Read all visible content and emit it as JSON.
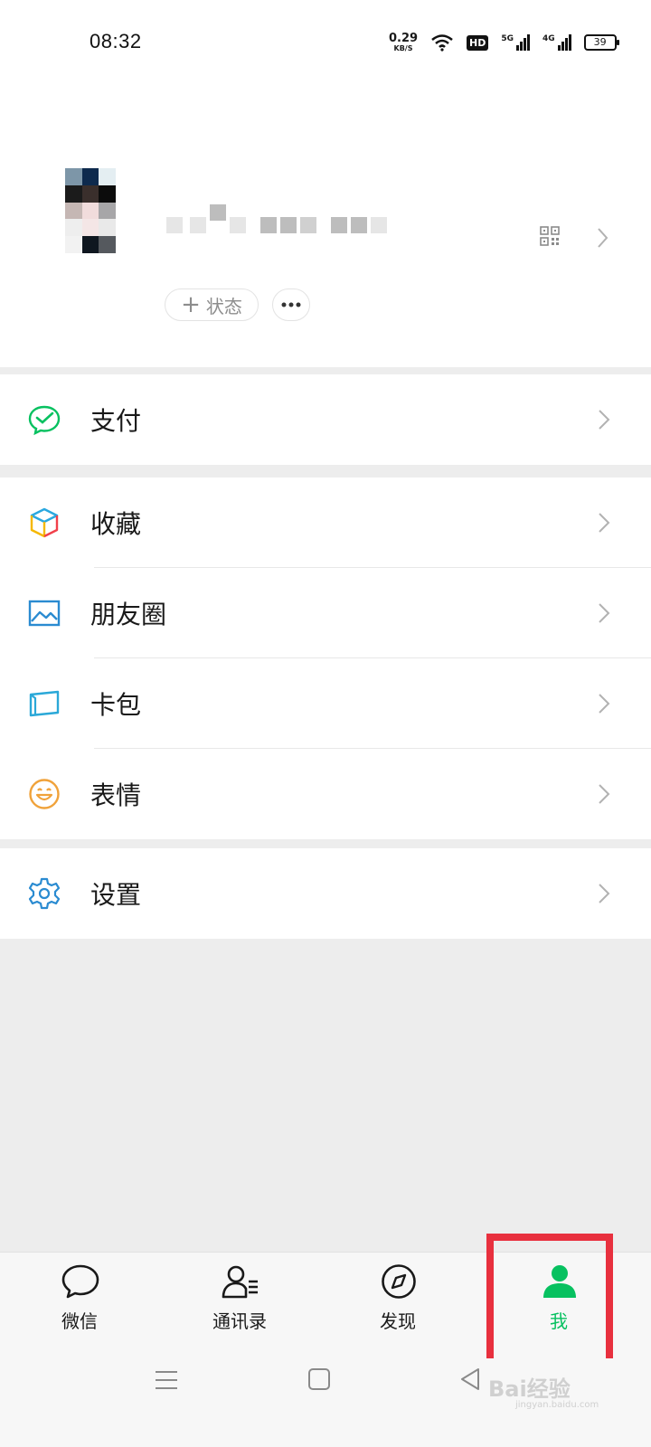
{
  "status_bar": {
    "time": "08:32",
    "net_speed": "0.29",
    "net_unit": "KB/S",
    "hd": "HD",
    "sim1": "5G",
    "sim2": "4G",
    "battery": "39"
  },
  "profile": {
    "status_label": "状态",
    "status_plus": "+"
  },
  "menu": {
    "pay": "支付",
    "favorites": "收藏",
    "moments": "朋友圈",
    "cards": "卡包",
    "stickers": "表情",
    "settings": "设置"
  },
  "tabs": [
    {
      "label": "微信",
      "icon": "chat-bubble-icon"
    },
    {
      "label": "通讯录",
      "icon": "contacts-icon"
    },
    {
      "label": "发现",
      "icon": "compass-icon"
    },
    {
      "label": "我",
      "icon": "person-icon",
      "active": true
    }
  ],
  "watermark": {
    "text": "Bai经验",
    "sub": "jingyan.baidu.com"
  },
  "colors": {
    "accent": "#07c160",
    "highlight": "#e8303e",
    "background": "#ededed"
  }
}
